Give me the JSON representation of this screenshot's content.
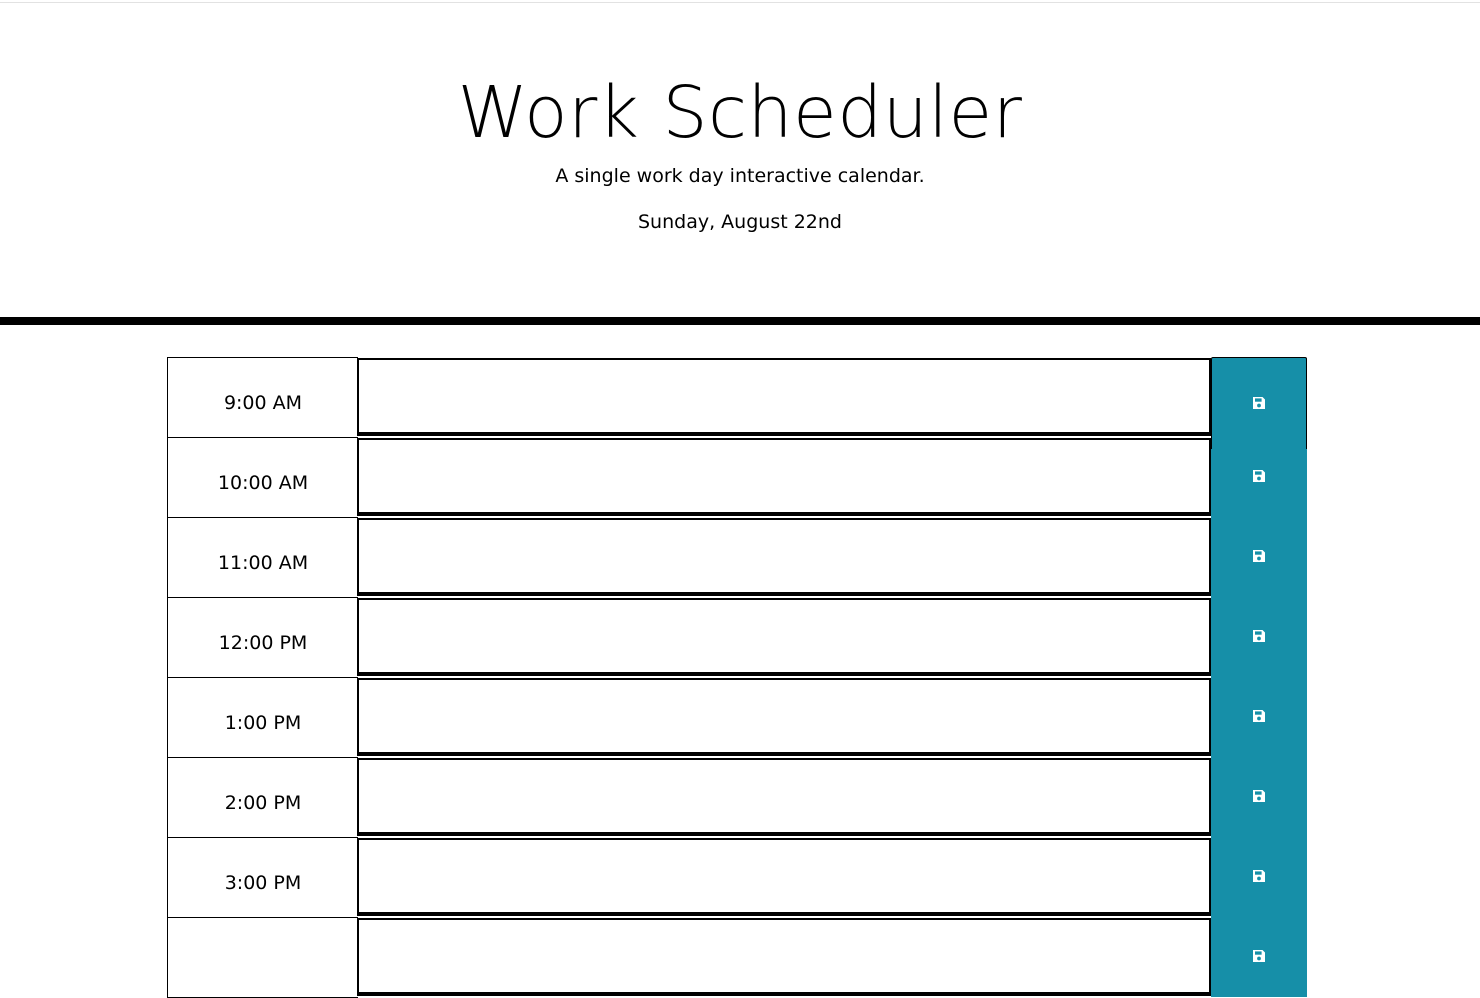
{
  "header": {
    "title": "Work Scheduler",
    "subtitle": "A single work day interactive calendar.",
    "current_day": "Sunday, August 22nd"
  },
  "colors": {
    "save_button": "#168fa8",
    "rule": "#000000"
  },
  "schedule": {
    "rows": [
      {
        "hour": "9:00 AM",
        "description": "",
        "save_icon": "floppy-disk-icon"
      },
      {
        "hour": "10:00 AM",
        "description": "",
        "save_icon": "floppy-disk-icon"
      },
      {
        "hour": "11:00 AM",
        "description": "",
        "save_icon": "floppy-disk-icon"
      },
      {
        "hour": "12:00 PM",
        "description": "",
        "save_icon": "floppy-disk-icon"
      },
      {
        "hour": "1:00 PM",
        "description": "",
        "save_icon": "floppy-disk-icon"
      },
      {
        "hour": "2:00 PM",
        "description": "",
        "save_icon": "floppy-disk-icon"
      },
      {
        "hour": "3:00 PM",
        "description": "",
        "save_icon": "floppy-disk-icon"
      },
      {
        "hour": "",
        "description": "",
        "save_icon": "floppy-disk-icon"
      }
    ]
  }
}
